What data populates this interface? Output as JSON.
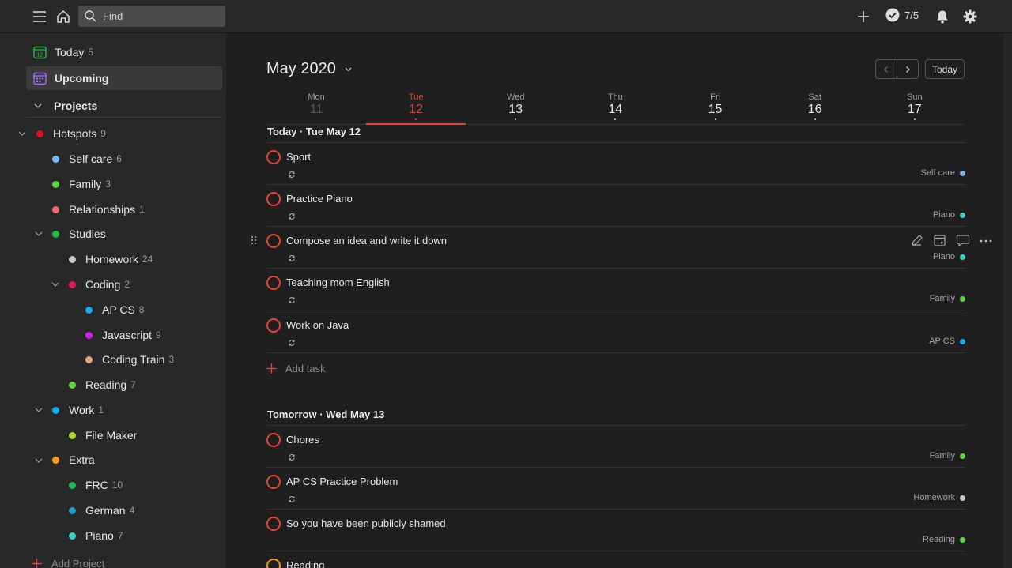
{
  "topbar": {
    "search_placeholder": "Find",
    "karma": "7/5"
  },
  "sidebar": {
    "nav": [
      {
        "label": "Today",
        "count": "5"
      },
      {
        "label": "Upcoming"
      }
    ],
    "projects_label": "Projects",
    "projects": [
      {
        "name": "Hotspots",
        "count": "9",
        "color": "#e8111b"
      },
      {
        "name": "Self care",
        "count": "6",
        "color": "#7ab9f0"
      },
      {
        "name": "Family",
        "count": "3",
        "color": "#5ed343"
      },
      {
        "name": "Relationships",
        "count": "1",
        "color": "#f06a6a"
      },
      {
        "name": "Studies",
        "count": "",
        "color": "#25b84c"
      },
      {
        "name": "Homework",
        "count": "24",
        "color": "#c9c9c9"
      },
      {
        "name": "Coding",
        "count": "2",
        "color": "#e0165e"
      },
      {
        "name": "AP CS",
        "count": "8",
        "color": "#14aaf5"
      },
      {
        "name": "Javascript",
        "count": "9",
        "color": "#d01ee8"
      },
      {
        "name": "Coding Train",
        "count": "3",
        "color": "#e0a68a"
      },
      {
        "name": "Reading",
        "count": "7",
        "color": "#5ed343"
      },
      {
        "name": "Work",
        "count": "1",
        "color": "#14aaf5"
      },
      {
        "name": "File Maker",
        "count": "",
        "color": "#afd82a"
      },
      {
        "name": "Extra",
        "count": "",
        "color": "#ff9a14"
      },
      {
        "name": "FRC",
        "count": "10",
        "color": "#25b84c"
      },
      {
        "name": "German",
        "count": "4",
        "color": "#1f9fc9"
      },
      {
        "name": "Piano",
        "count": "7",
        "color": "#3bd1c7"
      }
    ],
    "add_project": "Add Project"
  },
  "main": {
    "month": "May 2020",
    "today_button": "Today",
    "days": [
      {
        "name": "Mon",
        "date": "11"
      },
      {
        "name": "Tue",
        "date": "12"
      },
      {
        "name": "Wed",
        "date": "13"
      },
      {
        "name": "Thu",
        "date": "14"
      },
      {
        "name": "Fri",
        "date": "15"
      },
      {
        "name": "Sat",
        "date": "16"
      },
      {
        "name": "Sun",
        "date": "17"
      }
    ],
    "sections": [
      {
        "title": "Today · Tue May 12",
        "tasks": [
          {
            "title": "Sport",
            "project": "Self care",
            "color": "#7ab9f0"
          },
          {
            "title": "Practice Piano",
            "project": "Piano",
            "color": "#3bd1c7"
          },
          {
            "title": "Compose an idea and write it down",
            "project": "Piano",
            "color": "#3bd1c7"
          },
          {
            "title": "Teaching mom English",
            "project": "Family",
            "color": "#5ed343"
          },
          {
            "title": "Work on Java",
            "project": "AP CS",
            "color": "#14aaf5"
          }
        ],
        "add_task": "Add task"
      },
      {
        "title": "Tomorrow · Wed May 13",
        "tasks": [
          {
            "title": "Chores",
            "project": "Family",
            "color": "#5ed343"
          },
          {
            "title": "AP CS Practice Problem",
            "project": "Homework",
            "color": "#c9c9c9"
          },
          {
            "title": "So you have been publicly shamed",
            "project": "Reading",
            "color": "#5ed343"
          },
          {
            "title": "Reading"
          }
        ]
      }
    ]
  }
}
